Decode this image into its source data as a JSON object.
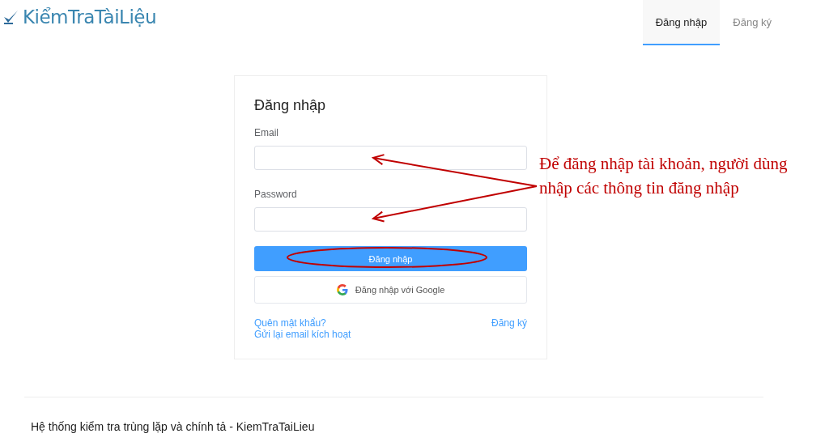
{
  "header": {
    "logo": "KiểmTraTàiLiệu",
    "nav": [
      {
        "label": "Đăng nhập",
        "selected": true
      },
      {
        "label": "Đăng ký",
        "selected": false
      }
    ]
  },
  "login_card": {
    "title": "Đăng nhập",
    "fields": [
      {
        "label": "Email"
      },
      {
        "label": "Password"
      }
    ],
    "submit_button": "Đăng nhập",
    "google_button": "Đăng nhập với Google",
    "forgot_link": "Quên mật khẩu?",
    "resend_link": "Gửi lại email kích hoạt",
    "register_link": "Đăng ký"
  },
  "footer": {
    "text": "Hệ thống kiểm tra trùng lặp và chính tả - KiemTraTaiLieu"
  },
  "annotation": {
    "text": "Để đăng nhập tài khoản, người dùng nhập các thông tin đăng nhập"
  }
}
